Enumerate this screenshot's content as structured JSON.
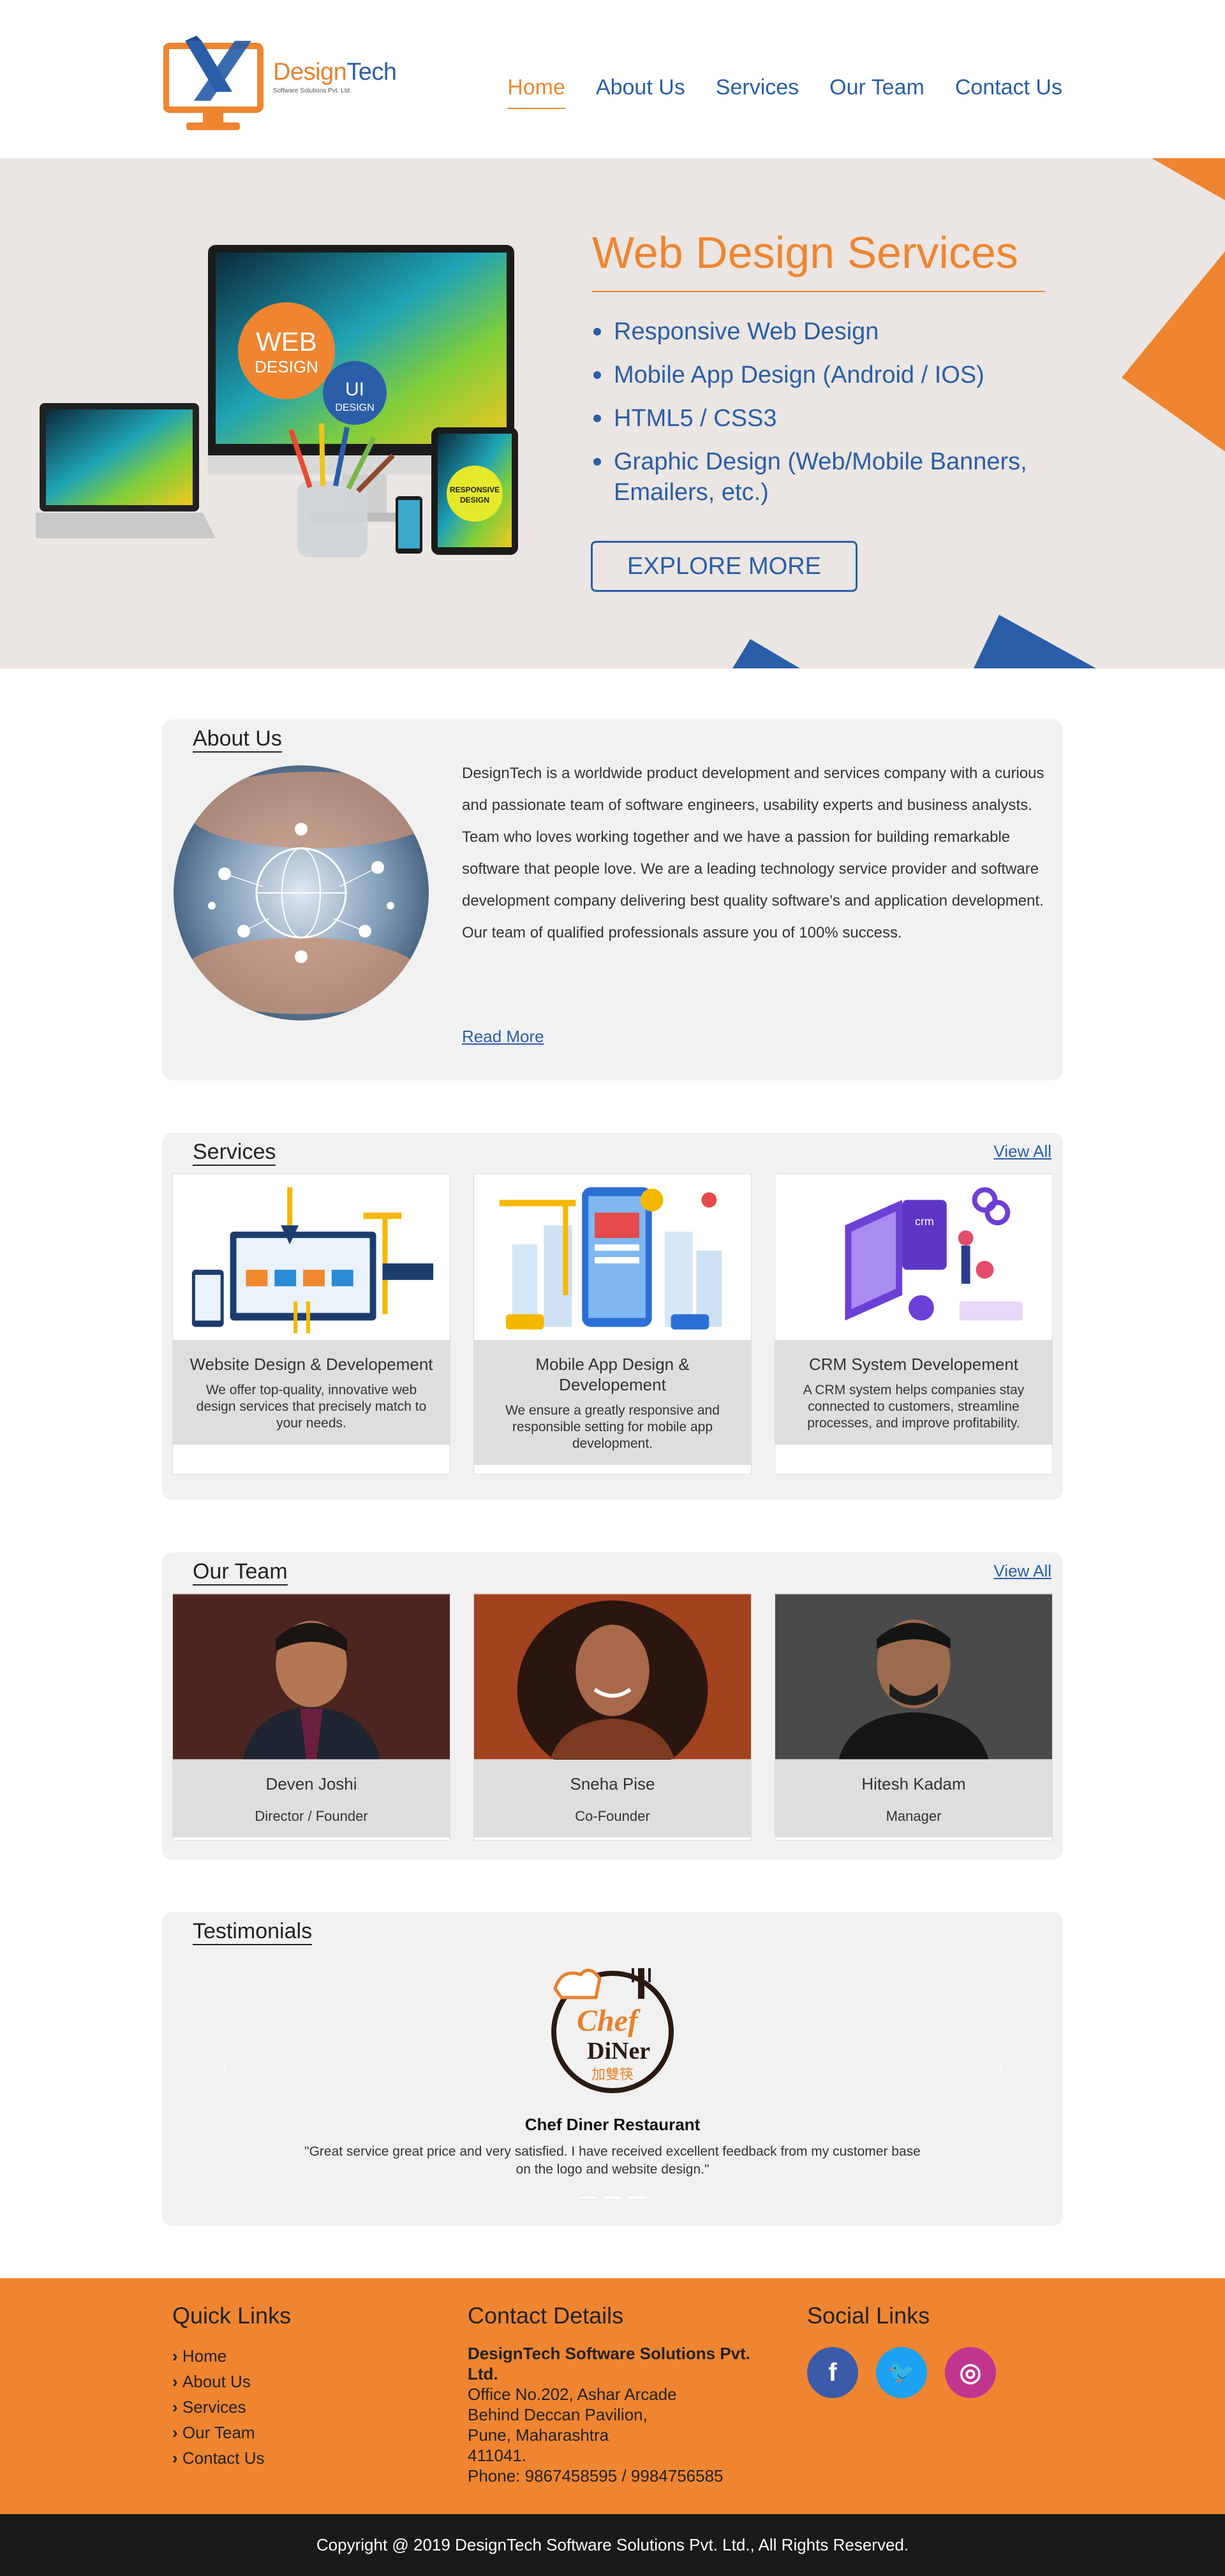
{
  "brand": {
    "name_part1": "Design",
    "name_part2": "Tech",
    "tagline": "Software Solutions Pvt. Ltd."
  },
  "nav": [
    {
      "label": "Home",
      "active": true
    },
    {
      "label": "About Us"
    },
    {
      "label": "Services"
    },
    {
      "label": "Our Team"
    },
    {
      "label": "Contact Us"
    }
  ],
  "hero": {
    "title": "Web Design Services",
    "items": [
      "Responsive Web Design",
      "Mobile App Design (Android / IOS)",
      "HTML5 / CSS3",
      "Graphic Design (Web/Mobile Banners, Emailers, etc.)"
    ],
    "button": "EXPLORE MORE",
    "illustration": {
      "web_badge": "WEB",
      "web_badge_sub": "DESIGN",
      "ui_badge": "UI",
      "ui_badge_sub": "DESIGN",
      "responsive_badge": "RESPONSIVE",
      "responsive_badge_sub": "DESIGN"
    }
  },
  "about": {
    "title": "About Us",
    "text": "DesignTech is a worldwide product development and services company with a curious and passionate team of software engineers, usability experts and business analysts. Team who loves working together and we have a passion for building remarkable software that people love. We are a leading technology service provider and software development company delivering best quality software's and application development. Our team of qualified professionals assure you of 100% success.",
    "read_more": "Read More"
  },
  "services": {
    "title": "Services",
    "view_all": "View All",
    "items": [
      {
        "title": "Website Design & Developement",
        "desc": "We offer top-quality, innovative web design services that precisely match to your needs."
      },
      {
        "title": "Mobile App Design & Developement",
        "desc": "We ensure a greatly responsive and responsible setting for mobile app development."
      },
      {
        "title": "CRM System Developement",
        "desc": "A CRM system helps companies stay connected to customers, streamline processes, and improve profitability."
      }
    ]
  },
  "team": {
    "title": "Our Team",
    "view_all": "View All",
    "members": [
      {
        "name": "Deven Joshi",
        "role": "Director / Founder"
      },
      {
        "name": "Sneha Pise",
        "role": "Co-Founder"
      },
      {
        "name": "Hitesh Kadam",
        "role": "Manager"
      }
    ]
  },
  "testimonials": {
    "title": "Testimonials",
    "logo_text_1": "Chef",
    "logo_text_2": "DiNer",
    "logo_text_3": "加雙筷",
    "name": "Chef Diner Restaurant",
    "quote": "\"Great service great price and very satisfied. I have received excellent feedback from my customer base on the logo and website design.\"",
    "prev_arrow": "‹",
    "next_arrow": "›"
  },
  "footer": {
    "quick_links_title": "Quick Links",
    "quick_links": [
      "Home",
      "About Us",
      "Services",
      "Our Team",
      "Contact Us"
    ],
    "contact_title": "Contact Details",
    "company": "DesignTech Software Solutions Pvt. Ltd.",
    "address_lines": [
      "Office No.202, Ashar Arcade",
      "Behind Deccan Pavilion,",
      "Pune, Maharashtra",
      "411041."
    ],
    "phone": "Phone: 9867458595 / 9984756585",
    "social_title": "Social Links",
    "socials": [
      {
        "icon": "facebook-icon",
        "glyph": "f",
        "color": "#3b5ba8"
      },
      {
        "icon": "twitter-icon",
        "glyph": "🐦",
        "color": "#1da1f2"
      },
      {
        "icon": "instagram-icon",
        "glyph": "◎",
        "color": "#c1358f"
      }
    ],
    "copyright": "Copyright @ 2019 DesignTech Software Solutions Pvt. Ltd., All Rights Reserved."
  },
  "colors": {
    "accent_orange": "#ef8530",
    "accent_blue": "#2a5ea8",
    "hero_bg": "#ebe6e3",
    "card_bg": "#f1f1f1",
    "footer_bg": "#ef8530",
    "copyright_bg": "#1a1a1a"
  }
}
